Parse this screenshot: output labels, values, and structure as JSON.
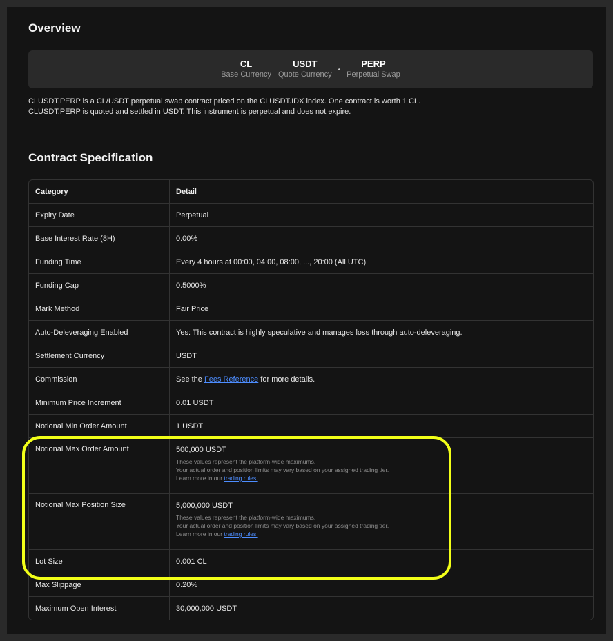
{
  "overview": {
    "title": "Overview",
    "symbols": [
      {
        "code": "CL",
        "label": "Base Currency"
      },
      {
        "code": "USDT",
        "label": "Quote Currency"
      },
      {
        "code": "PERP",
        "label": "Perpetual Swap"
      }
    ],
    "separator": "•",
    "description": [
      "CLUSDT.PERP is a CL/USDT perpetual swap contract priced on the CLUSDT.IDX index. One contract is worth 1 CL.",
      "CLUSDT.PERP is quoted and settled in USDT. This instrument is perpetual and does not expire."
    ]
  },
  "spec": {
    "title": "Contract Specification",
    "header": {
      "category": "Category",
      "detail": "Detail"
    },
    "rows": [
      {
        "category": "Expiry Date",
        "detail": "Perpetual"
      },
      {
        "category": "Base Interest Rate (8H)",
        "detail": "0.00%"
      },
      {
        "category": "Funding Time",
        "detail": "Every 4 hours at 00:00, 04:00, 08:00, ..., 20:00 (All UTC)"
      },
      {
        "category": "Funding Cap",
        "detail": "0.5000%"
      },
      {
        "category": "Mark Method",
        "detail": "Fair Price"
      },
      {
        "category": "Auto-Deleveraging Enabled",
        "detail": "Yes: This contract is highly speculative and manages loss through auto-deleveraging."
      },
      {
        "category": "Settlement Currency",
        "detail": "USDT"
      },
      {
        "category": "Commission",
        "detail_prefix": "See the ",
        "link": "Fees Reference",
        "detail_suffix": " for more details."
      },
      {
        "category": "Minimum Price Increment",
        "detail": "0.01 USDT"
      },
      {
        "category": "Notional Min Order Amount",
        "detail": "1 USDT"
      },
      {
        "category": "Notional Max Order Amount",
        "detail": "500,000 USDT"
      },
      {
        "category": "Notional Max Position Size",
        "detail": "5,000,000 USDT"
      },
      {
        "category": "Lot Size",
        "detail": "0.001 CL"
      },
      {
        "category": "Max Slippage",
        "detail": "0.20%"
      },
      {
        "category": "Maximum Open Interest",
        "detail": "30,000,000 USDT"
      }
    ],
    "note": {
      "line1": "These values represent the platform-wide maximums.",
      "line2": "Your actual order and position limits may vary based on your assigned trading tier.",
      "line3_prefix": "Learn more in our ",
      "line3_link": "trading rules."
    }
  },
  "colors": {
    "highlight": "#f2ff18",
    "link": "#4d8dff",
    "background": "#141414"
  }
}
